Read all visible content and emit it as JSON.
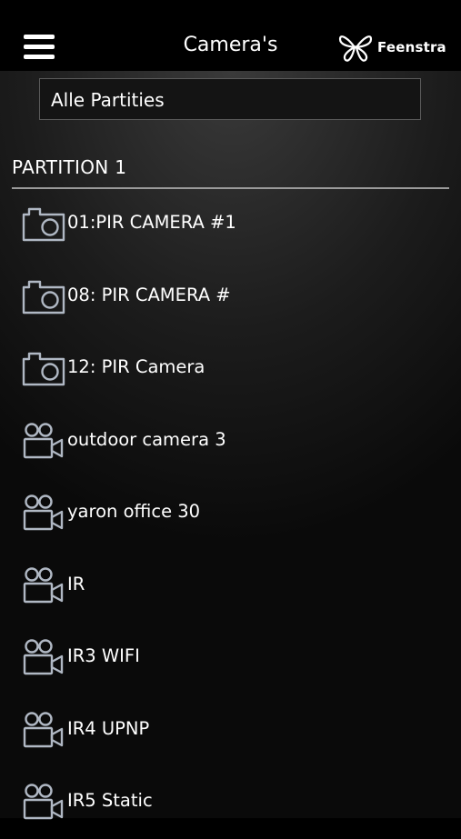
{
  "header": {
    "title": "Camera's",
    "brand": "Feenstra",
    "menu_icon": "hamburger-icon",
    "brand_icon": "butterfly-logo-icon"
  },
  "filter": {
    "selected": "Alle Partities"
  },
  "section": {
    "title": "PARTITION 1"
  },
  "cameras": [
    {
      "label": "01:PIR CAMERA #1",
      "icon": "still-camera-icon"
    },
    {
      "label": "08: PIR CAMERA #",
      "icon": "still-camera-icon"
    },
    {
      "label": "12: PIR Camera",
      "icon": "still-camera-icon"
    },
    {
      "label": "outdoor camera 3",
      "icon": "video-camera-icon"
    },
    {
      "label": "yaron office 30",
      "icon": "video-camera-icon"
    },
    {
      "label": "IR",
      "icon": "video-camera-icon"
    },
    {
      "label": "IR3 WIFI",
      "icon": "video-camera-icon"
    },
    {
      "label": "IR4 UPNP",
      "icon": "video-camera-icon"
    },
    {
      "label": "IR5 Static",
      "icon": "video-camera-icon"
    }
  ],
  "colors": {
    "background": "#000000",
    "icon_stroke": "#b0b8c4",
    "text": "#ffffff",
    "divider": "#9a9a9a"
  }
}
